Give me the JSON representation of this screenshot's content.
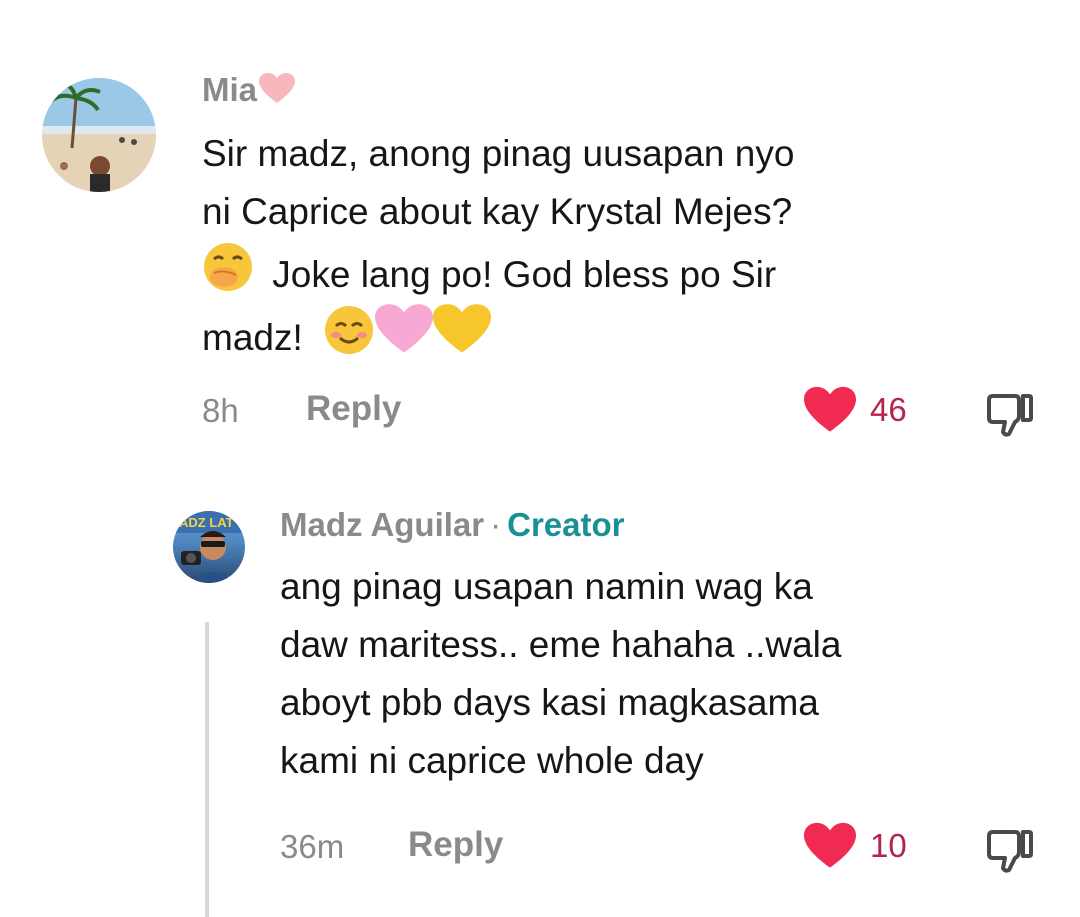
{
  "comments": [
    {
      "username": "Mia",
      "username_emoji_icon": "pink-heart-icon",
      "text_lines": [
        "Sir madz, anong pinag uusapan nyo",
        "ni Caprice about kay Krystal Mejes?",
        "Joke lang po! God bless po Sir",
        "madz!"
      ],
      "inline_emoji_icons": [
        "hand-over-mouth-emoji-icon",
        "smiling-face-emoji-icon",
        "pink-heart-icon",
        "yellow-heart-icon"
      ],
      "time": "8h",
      "reply_label": "Reply",
      "likes": "46"
    },
    {
      "username": "Madz Aguilar",
      "separator": "·",
      "badge": "Creator",
      "text_lines": [
        "ang pinag usapan namin wag ka",
        "daw maritess.. eme hahaha ..wala",
        "aboyt pbb days kasi magkasama",
        "kami ni caprice whole day"
      ],
      "time": "36m",
      "reply_label": "Reply",
      "likes": "10"
    }
  ],
  "colors": {
    "username_gray": "#8a8a8a",
    "creator_teal": "#198f96",
    "like_red": "#f02a50",
    "like_count": "#b5244a",
    "text": "#161616"
  }
}
